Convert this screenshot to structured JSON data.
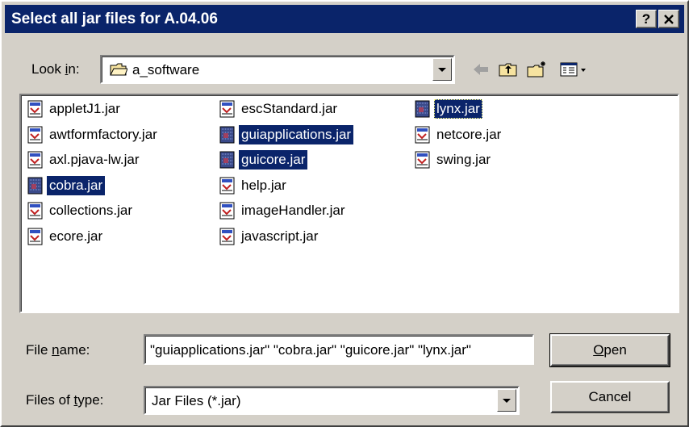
{
  "window": {
    "title": "Select all jar files for A.04.06",
    "help_label": "?",
    "close_label": "✕"
  },
  "lookin": {
    "label_pre": "Look ",
    "label_accel": "i",
    "label_post": "n:",
    "value": "a_software"
  },
  "toolbar": {
    "back_icon": "back-arrow-icon",
    "up_icon": "up-one-level-icon",
    "newfolder_icon": "new-folder-icon",
    "views_icon": "view-menu-icon"
  },
  "files": [
    {
      "name": "appletJ1.jar",
      "selected": false
    },
    {
      "name": "awtformfactory.jar",
      "selected": false
    },
    {
      "name": "axl.pjava-lw.jar",
      "selected": false
    },
    {
      "name": "cobra.jar",
      "selected": true
    },
    {
      "name": "collections.jar",
      "selected": false
    },
    {
      "name": "ecore.jar",
      "selected": false
    },
    {
      "name": "escStandard.jar",
      "selected": false
    },
    {
      "name": "guiapplications.jar",
      "selected": true
    },
    {
      "name": "guicore.jar",
      "selected": true
    },
    {
      "name": "help.jar",
      "selected": false
    },
    {
      "name": "imageHandler.jar",
      "selected": false
    },
    {
      "name": "javascript.jar",
      "selected": false
    },
    {
      "name": "lynx.jar",
      "selected": true
    },
    {
      "name": "netcore.jar",
      "selected": false
    },
    {
      "name": "swing.jar",
      "selected": false
    }
  ],
  "filename": {
    "label_pre": "File ",
    "label_accel": "n",
    "label_post": "ame:",
    "value": "\"guiapplications.jar\" \"cobra.jar\" \"guicore.jar\" \"lynx.jar\""
  },
  "filetype": {
    "label_pre": "Files of ",
    "label_accel": "t",
    "label_post": "ype:",
    "value": "Jar Files (*.jar)"
  },
  "buttons": {
    "open_accel": "O",
    "open_rest": "pen",
    "cancel": "Cancel"
  }
}
